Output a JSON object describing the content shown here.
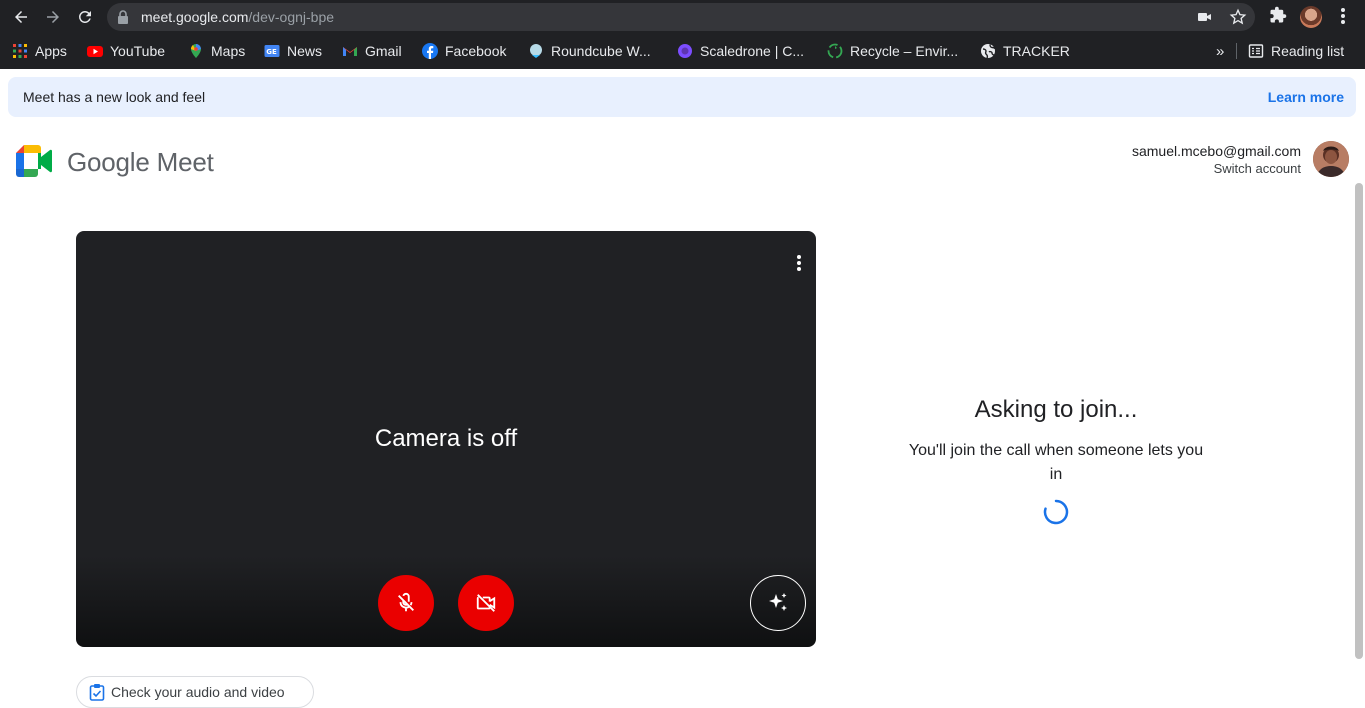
{
  "browser": {
    "url_host": "meet.google.com",
    "url_path": "/dev-ognj-bpe",
    "bookmarks": [
      {
        "label": "Apps",
        "icon": "apps-grid-icon"
      },
      {
        "label": "YouTube",
        "icon": "youtube-icon"
      },
      {
        "label": "Maps",
        "icon": "maps-icon"
      },
      {
        "label": "News",
        "icon": "news-icon"
      },
      {
        "label": "Gmail",
        "icon": "gmail-icon"
      },
      {
        "label": "Facebook",
        "icon": "facebook-icon"
      },
      {
        "label": "Roundcube W...",
        "icon": "roundcube-icon"
      },
      {
        "label": "Scaledrone | C...",
        "icon": "scaledrone-icon"
      },
      {
        "label": "Recycle – Envir...",
        "icon": "recycle-icon"
      },
      {
        "label": "TRACKER",
        "icon": "globe-icon"
      }
    ],
    "overflow_label": "»",
    "reading_list_label": "Reading list"
  },
  "banner": {
    "message": "Meet has a new look and feel",
    "link": "Learn more"
  },
  "header": {
    "brand": "Google Meet",
    "account_email": "samuel.mcebo@gmail.com",
    "switch_account": "Switch account"
  },
  "preview": {
    "camera_status": "Camera is off",
    "check_av_label": "Check your audio and video"
  },
  "join": {
    "title": "Asking to join...",
    "subtitle": "You'll join the call when someone lets you in"
  },
  "colors": {
    "accent_blue": "#1a73e8",
    "mute_red": "#ea0000",
    "chrome_dark": "#202124"
  }
}
